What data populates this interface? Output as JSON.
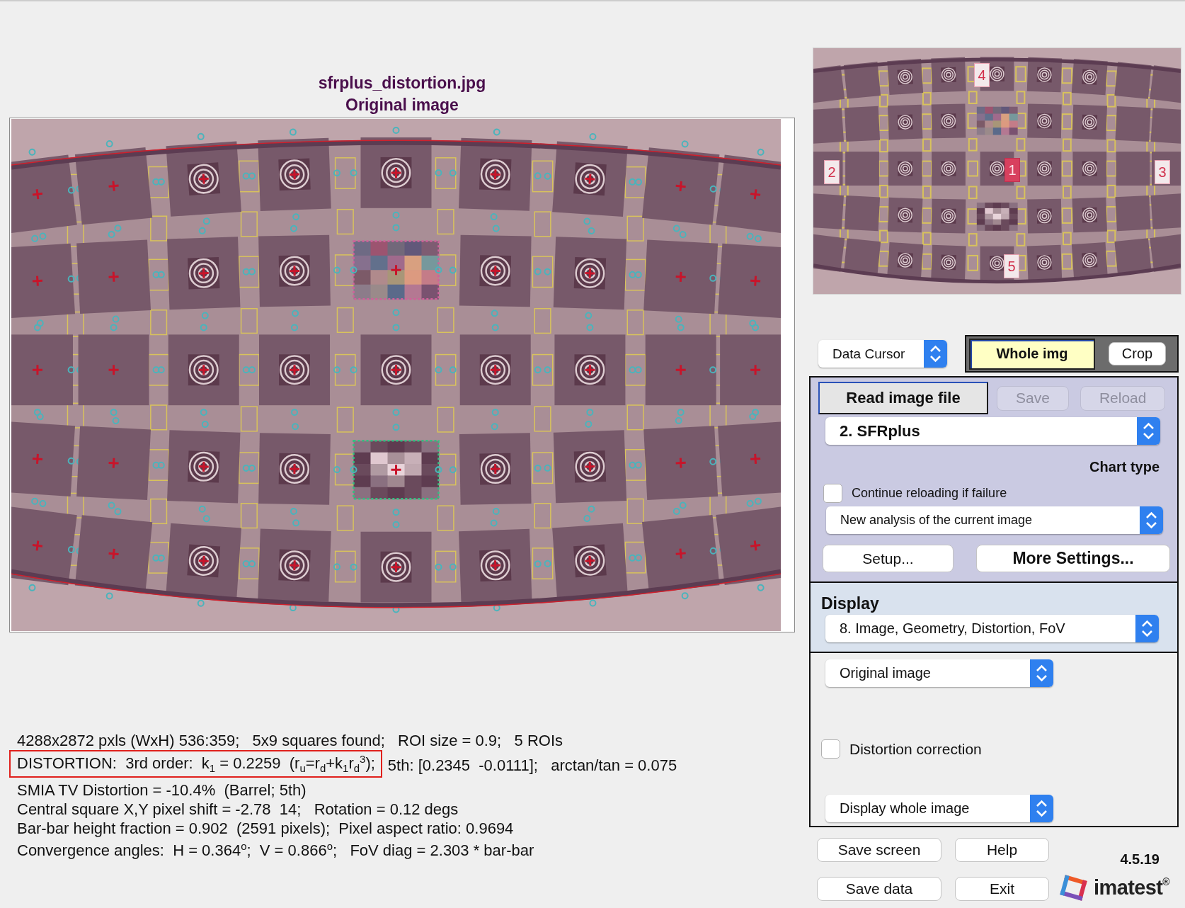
{
  "image_view": {
    "filename": "sfrplus_distortion.jpg",
    "subtitle": "Original image"
  },
  "results": [
    {
      "segments": [
        {
          "text": "4288x2872 pxls (WxH) 536:359;   5x9 squares found;   ROI size = 0.9;   5 ROIs",
          "boxed": false
        }
      ]
    },
    {
      "segments": [
        {
          "text": "DISTORTION:  3rd order:  k$_{1}$ = 0.2259  (r$_{u}$=r$_{d}$+k$_{1}$r$_{d}$$^{3}$);",
          "boxed": true
        },
        {
          "text": "5th: [0.2345  -0.0111];   arctan/tan = 0.075",
          "boxed": false
        }
      ]
    },
    {
      "segments": [
        {
          "text": "SMIA TV Distortion = -10.4%  (Barrel; 5th)",
          "boxed": false
        }
      ]
    },
    {
      "segments": [
        {
          "text": "Central square X,Y pixel shift = -2.78  14;   Rotation = 0.12 degs",
          "boxed": false
        }
      ]
    },
    {
      "segments": [
        {
          "text": "Bar-bar height fraction = 0.902  (2591 pixels);  Pixel aspect ratio: 0.9694",
          "boxed": false
        }
      ]
    },
    {
      "segments": [
        {
          "text": "Convergence angles:  H = 0.364$^{o}$;  V = 0.866$^{o}$;   FoV diag = 2.303 * bar-bar",
          "boxed": false
        }
      ]
    }
  ],
  "thumbnail": {
    "roi_labels": [
      {
        "label": "4",
        "selected": false
      },
      {
        "label": "2",
        "selected": false
      },
      {
        "label": "1",
        "selected": true
      },
      {
        "label": "3",
        "selected": false
      },
      {
        "label": "5",
        "selected": false
      }
    ]
  },
  "cursor_mode": {
    "value": "Data Cursor"
  },
  "view_toggle": [
    {
      "label": "Whole img",
      "selected": true
    },
    {
      "label": "Crop",
      "selected": false
    }
  ],
  "file_panel": {
    "buttons": [
      {
        "label": "Read image file",
        "kind": "primary",
        "disabled": false
      },
      {
        "label": "Save",
        "kind": "plain",
        "disabled": true
      },
      {
        "label": "Reload",
        "kind": "plain",
        "disabled": true
      }
    ],
    "chart_type": {
      "value": "2. SFRplus",
      "label": "Chart type"
    },
    "continue_reloading": {
      "label": "Continue reloading if failure",
      "checked": false
    },
    "analysis_mode": {
      "value": "New analysis of the current image"
    },
    "settings_buttons": [
      {
        "label": "Setup...",
        "bold": false
      },
      {
        "label": "More Settings...",
        "bold": true
      }
    ]
  },
  "display_panel": {
    "label": "Display",
    "value": "8. Image, Geometry, Distortion, FoV"
  },
  "options_panel": {
    "image_mode": {
      "value": "Original image"
    },
    "distortion_correction": {
      "label": "Distortion correction",
      "checked": false
    },
    "view_extent": {
      "value": "Display whole image"
    }
  },
  "footer": {
    "buttons": [
      "Save screen",
      "Help",
      "Save data",
      "Exit"
    ],
    "version": "4.5.19",
    "logo": "imatest$^{®}$"
  }
}
